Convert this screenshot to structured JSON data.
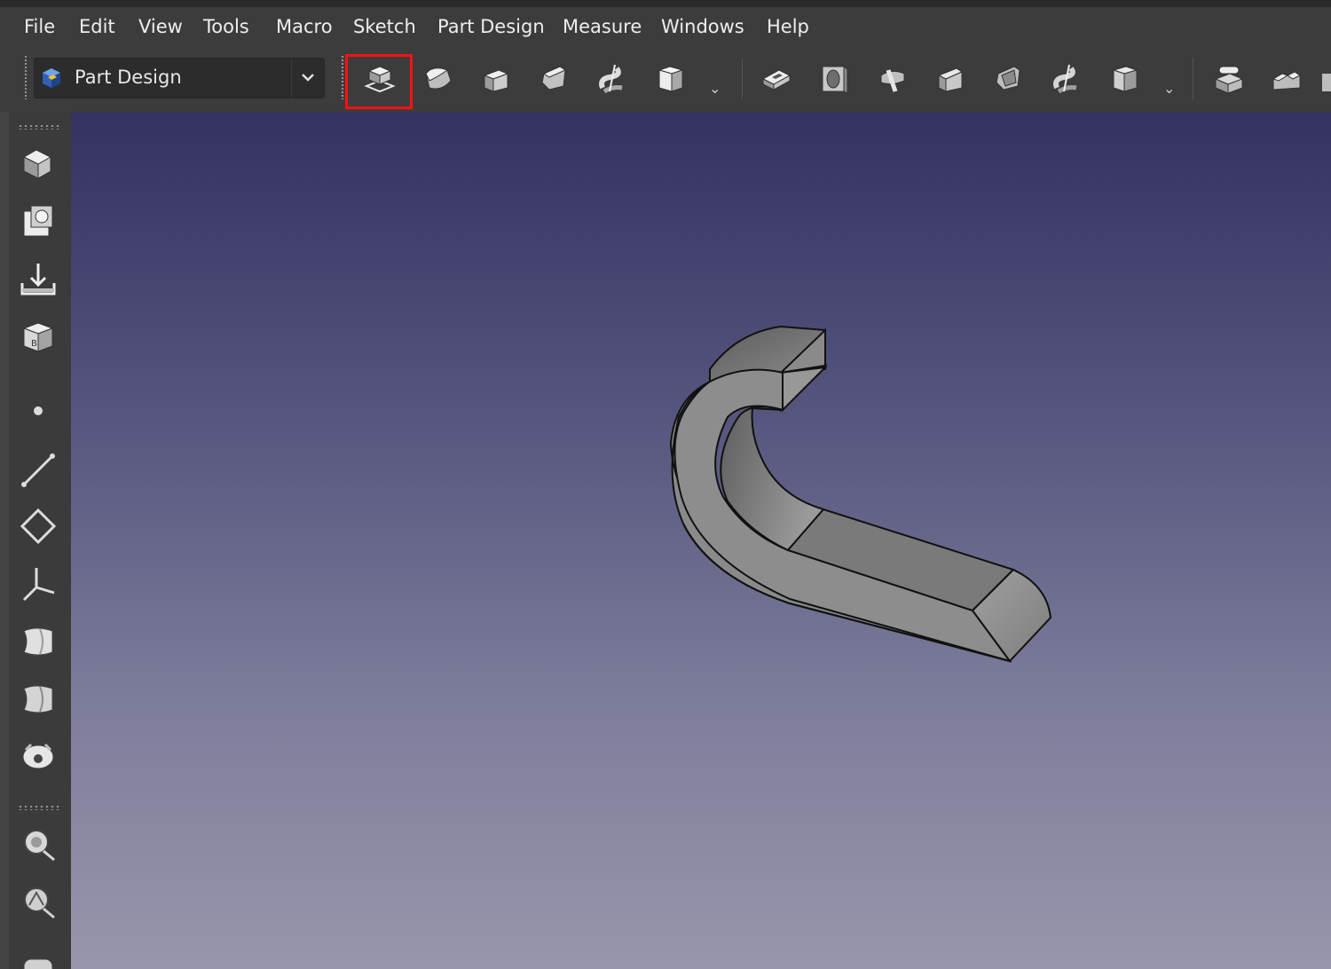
{
  "menu": {
    "items": [
      {
        "label": "File"
      },
      {
        "label": "Edit"
      },
      {
        "label": "View"
      },
      {
        "label": "Tools"
      },
      {
        "label": "Macro"
      },
      {
        "label": "Sketch"
      },
      {
        "label": "Part Design"
      },
      {
        "label": "Measure"
      },
      {
        "label": "Windows"
      },
      {
        "label": "Help"
      }
    ]
  },
  "toolbar": {
    "workbench_label": "Part Design",
    "buttons": [
      "pad-icon",
      "revolution-icon",
      "additive-loft-icon",
      "additive-pipe-icon",
      "additive-helix-icon",
      "additive-primitive-icon",
      "pocket-icon",
      "hole-icon",
      "groove-icon",
      "subtractive-loft-icon",
      "subtractive-pipe-icon",
      "subtractive-helix-icon",
      "subtractive-primitive-icon",
      "fillet-icon",
      "chamfer-icon"
    ],
    "highlighted_button": "pad-icon",
    "highlight_color": "#ff1010"
  },
  "left_toolbar": {
    "buttons": [
      "body-icon",
      "shape-binder-icon",
      "sub-shape-binder-icon",
      "clone-icon",
      "datum-point-icon",
      "datum-line-icon",
      "datum-plane-icon",
      "local-coordinate-system-icon",
      "additive-shape-icon",
      "subtractive-shape-icon",
      "mirror-icon",
      "measure-linear-icon",
      "measure-angular-icon",
      "measure-clear-icon"
    ]
  },
  "viewport": {
    "background_top": "#343260",
    "background_bottom": "#9696ac",
    "model": "swept-solid"
  }
}
